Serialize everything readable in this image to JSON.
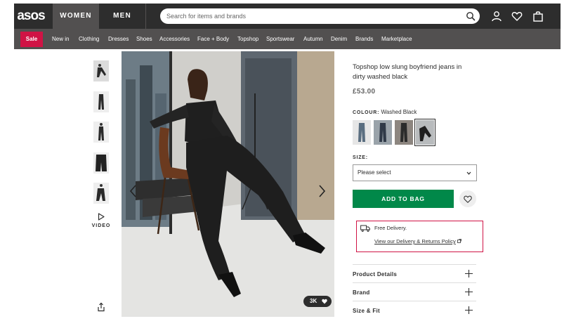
{
  "header": {
    "logo": "asos",
    "tabs": [
      {
        "label": "WOMEN",
        "active": true
      },
      {
        "label": "MEN",
        "active": false
      }
    ],
    "search_placeholder": "Search for items and brands",
    "icons": [
      "search-icon",
      "account-icon",
      "saved-items-heart-icon",
      "bag-icon"
    ]
  },
  "nav": {
    "sale": "Sale",
    "items": [
      "New in",
      "Clothing",
      "Dresses",
      "Shoes",
      "Accessories",
      "Face + Body",
      "Topshop",
      "Sportswear",
      "Autumn",
      "Denim",
      "Brands",
      "Marketplace"
    ]
  },
  "gallery": {
    "thumbnail_count": 5,
    "video_label": "VIDEO",
    "likes": "3K",
    "icons": [
      "chevron-left-icon",
      "chevron-right-icon",
      "share-icon",
      "play-icon",
      "heart-icon"
    ]
  },
  "product": {
    "title": "Topshop low slung boyfriend jeans in dirty washed black",
    "price": "£53.00",
    "colour_label": "COLOUR:",
    "colour_value": "Washed Black",
    "swatches": 4,
    "selected_swatch": 4,
    "size_label": "SIZE:",
    "size_placeholder": "Please select",
    "add_to_bag": "ADD TO BAG",
    "delivery": {
      "text": "Free Delivery.",
      "link": "View our Delivery & Returns Policy"
    },
    "accordion": [
      "Product Details",
      "Brand",
      "Size & Fit"
    ]
  },
  "colors": {
    "header_bg": "#2d2d2d",
    "nav_bg": "#525050",
    "sale": "#d01345",
    "add_to_bag": "#018849",
    "highlight_border": "#d01345"
  }
}
